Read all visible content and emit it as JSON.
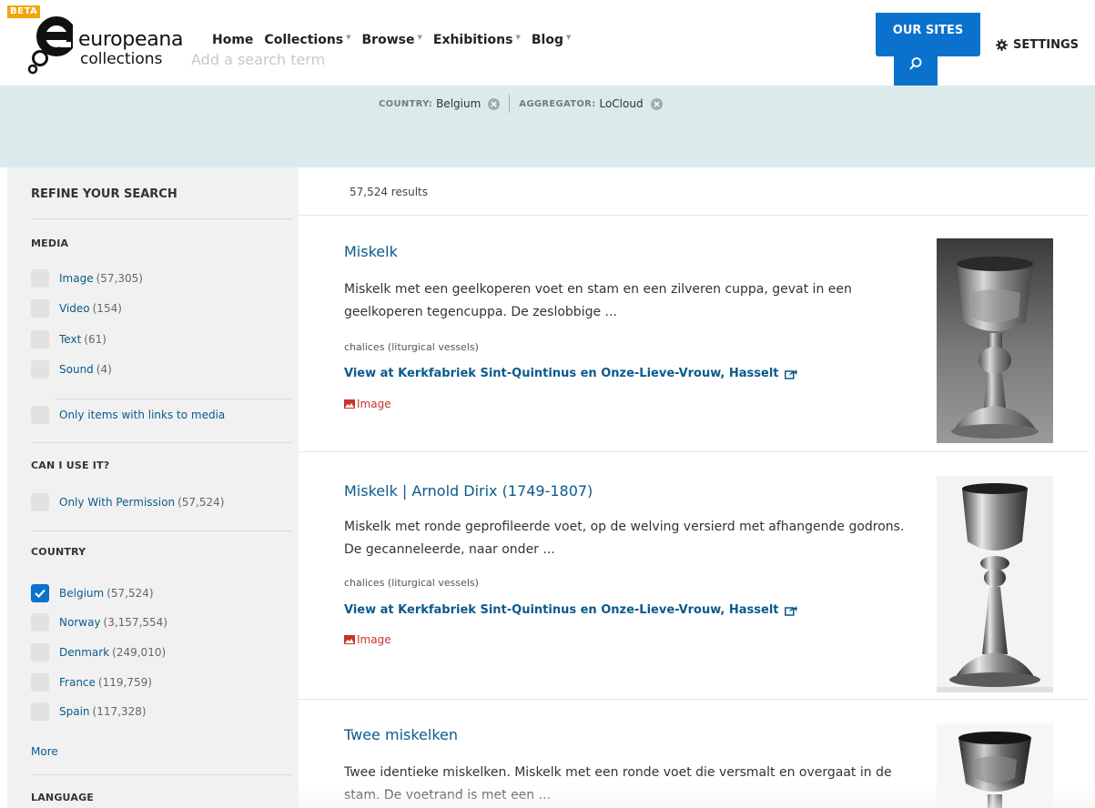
{
  "header": {
    "beta_label": "BETA",
    "logo_line1": "europeana",
    "logo_line2": "collections",
    "search_placeholder": "Add a search term",
    "nav": [
      {
        "label": "Home",
        "has_menu": false
      },
      {
        "label": "Collections",
        "has_menu": true
      },
      {
        "label": "Browse",
        "has_menu": true
      },
      {
        "label": "Exhibitions",
        "has_menu": true
      },
      {
        "label": "Blog",
        "has_menu": true
      }
    ],
    "our_sites_label": "OUR SITES",
    "settings_label": "SETTINGS"
  },
  "filters": [
    {
      "key": "COUNTRY:",
      "value": "Belgium"
    },
    {
      "key": "AGGREGATOR:",
      "value": "LoCloud"
    }
  ],
  "sidebar": {
    "title": "REFINE YOUR SEARCH",
    "media": {
      "heading": "MEDIA",
      "items": [
        {
          "label": "Image",
          "count": "(57,305)",
          "checked": false
        },
        {
          "label": "Video",
          "count": "(154)",
          "checked": false
        },
        {
          "label": "Text",
          "count": "(61)",
          "checked": false
        },
        {
          "label": "Sound",
          "count": "(4)",
          "checked": false
        }
      ],
      "links_option": "Only items with links to media"
    },
    "rights": {
      "heading": "CAN I USE IT?",
      "items": [
        {
          "label": "Only With Permission",
          "count": "(57,524)",
          "checked": false
        }
      ]
    },
    "country": {
      "heading": "COUNTRY",
      "items": [
        {
          "label": "Belgium",
          "count": "(57,524)",
          "checked": true
        },
        {
          "label": "Norway",
          "count": "(3,157,554)",
          "checked": false
        },
        {
          "label": "Denmark",
          "count": "(249,010)",
          "checked": false
        },
        {
          "label": "France",
          "count": "(119,759)",
          "checked": false
        },
        {
          "label": "Spain",
          "count": "(117,328)",
          "checked": false
        }
      ],
      "more_label": "More"
    },
    "language": {
      "heading": "LANGUAGE"
    }
  },
  "results": {
    "count_text": "57,524 results",
    "items": [
      {
        "title": "Miskelk",
        "description": "Miskelk met een geelkoperen voet en stam en een zilveren cuppa, gevat in een geelkoperen tegencuppa. De zeslobbige ...",
        "subject": "chalices (liturgical vessels)",
        "provider": "View at Kerkfabriek Sint-Quintinus en Onze-Lieve-Vrouw, Hasselt",
        "type": "Image"
      },
      {
        "title": "Miskelk | Arnold Dirix (1749-1807)",
        "description": "Miskelk met ronde geprofileerde voet, op de welving versierd met afhangende godrons. De gecanneleerde, naar onder ...",
        "subject": "chalices (liturgical vessels)",
        "provider": "View at Kerkfabriek Sint-Quintinus en Onze-Lieve-Vrouw, Hasselt",
        "type": "Image"
      },
      {
        "title": "Twee miskelken",
        "description": "Twee identieke miskelken. Miskelk met een ronde voet die versmalt en overgaat in de stam. De voetrand is met een ..."
      }
    ]
  },
  "colors": {
    "accent": "#0a72cc",
    "link": "#0a5a8c",
    "filter_band": "#dbebeb",
    "sidebar_bg": "#f1f1f1",
    "beta": "#f0a70a",
    "media_type": "#c7352a"
  }
}
